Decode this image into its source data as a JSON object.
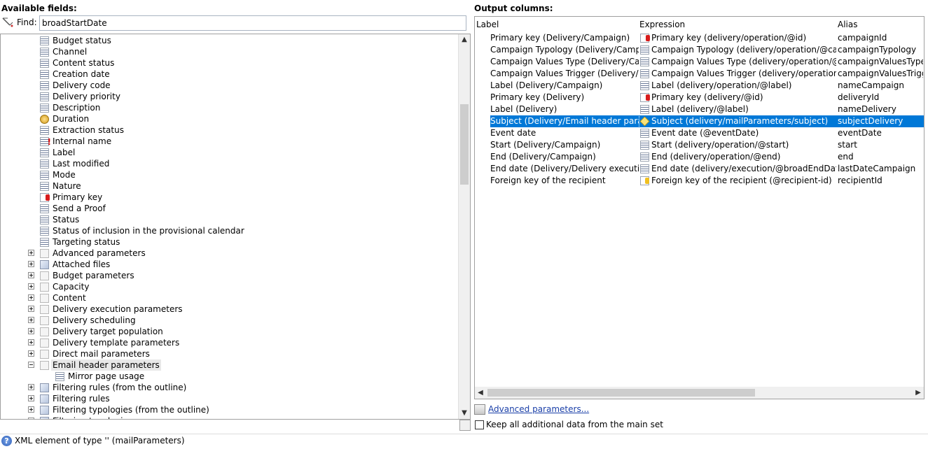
{
  "left_panel": {
    "heading": "Available fields:",
    "find_label": "Find:",
    "find_value": "broadStartDate",
    "tree_items": [
      {
        "label": "Budget status",
        "icon": "field-icon",
        "indent": 1,
        "expander": "none"
      },
      {
        "label": "Channel",
        "icon": "field-icon",
        "indent": 1,
        "expander": "none"
      },
      {
        "label": "Content status",
        "icon": "field-icon",
        "indent": 1,
        "expander": "none"
      },
      {
        "label": "Creation date",
        "icon": "field-icon",
        "indent": 1,
        "expander": "none"
      },
      {
        "label": "Delivery code",
        "icon": "field-icon",
        "indent": 1,
        "expander": "none"
      },
      {
        "label": "Delivery priority",
        "icon": "field-icon",
        "indent": 1,
        "expander": "none"
      },
      {
        "label": "Description",
        "icon": "field-icon",
        "indent": 1,
        "expander": "none"
      },
      {
        "label": "Duration",
        "icon": "duration-icon",
        "indent": 1,
        "expander": "none"
      },
      {
        "label": "Extraction status",
        "icon": "field-icon",
        "indent": 1,
        "expander": "none"
      },
      {
        "label": "Internal name",
        "icon": "mandatory-field-icon",
        "indent": 1,
        "expander": "none"
      },
      {
        "label": "Label",
        "icon": "field-icon",
        "indent": 1,
        "expander": "none"
      },
      {
        "label": "Last modified",
        "icon": "field-icon",
        "indent": 1,
        "expander": "none"
      },
      {
        "label": "Mode",
        "icon": "field-icon",
        "indent": 1,
        "expander": "none"
      },
      {
        "label": "Nature",
        "icon": "field-icon",
        "indent": 1,
        "expander": "none"
      },
      {
        "label": "Primary key",
        "icon": "primary-key-icon",
        "indent": 1,
        "expander": "none"
      },
      {
        "label": "Send a Proof",
        "icon": "field-icon",
        "indent": 1,
        "expander": "none"
      },
      {
        "label": "Status",
        "icon": "field-icon",
        "indent": 1,
        "expander": "none"
      },
      {
        "label": "Status of inclusion in the provisional calendar",
        "icon": "field-icon",
        "indent": 1,
        "expander": "none"
      },
      {
        "label": "Targeting status",
        "icon": "field-icon",
        "indent": 1,
        "expander": "none"
      },
      {
        "label": "Advanced parameters",
        "icon": "folder-icon",
        "indent": 1,
        "expander": "plus"
      },
      {
        "label": "Attached files",
        "icon": "link-icon",
        "indent": 1,
        "expander": "plus"
      },
      {
        "label": "Budget parameters",
        "icon": "folder-icon",
        "indent": 1,
        "expander": "plus"
      },
      {
        "label": "Capacity",
        "icon": "folder-icon",
        "indent": 1,
        "expander": "plus"
      },
      {
        "label": "Content",
        "icon": "folder-icon",
        "indent": 1,
        "expander": "plus"
      },
      {
        "label": "Delivery execution parameters",
        "icon": "folder-icon",
        "indent": 1,
        "expander": "plus"
      },
      {
        "label": "Delivery scheduling",
        "icon": "folder-icon",
        "indent": 1,
        "expander": "plus"
      },
      {
        "label": "Delivery target population",
        "icon": "folder-icon",
        "indent": 1,
        "expander": "plus"
      },
      {
        "label": "Delivery template parameters",
        "icon": "folder-icon",
        "indent": 1,
        "expander": "plus"
      },
      {
        "label": "Direct mail parameters",
        "icon": "folder-icon",
        "indent": 1,
        "expander": "plus"
      },
      {
        "label": "Email header parameters",
        "icon": "folder-icon",
        "indent": 1,
        "expander": "minus",
        "selected": true
      },
      {
        "label": "Mirror page usage",
        "icon": "field-icon",
        "indent": 2,
        "expander": "none"
      },
      {
        "label": "Filtering rules (from the outline)",
        "icon": "link-icon",
        "indent": 1,
        "expander": "plus"
      },
      {
        "label": "Filtering rules",
        "icon": "link-icon",
        "indent": 1,
        "expander": "plus"
      },
      {
        "label": "Filtering typologies (from the outline)",
        "icon": "link-icon",
        "indent": 1,
        "expander": "plus"
      },
      {
        "label": "Filtering typologies",
        "icon": "link-icon",
        "indent": 1,
        "expander": "plus"
      }
    ]
  },
  "right_panel": {
    "heading": "Output columns:",
    "columns": {
      "label": "Label",
      "expression": "Expression",
      "alias": "Alias"
    },
    "rows": [
      {
        "label": "Primary key (Delivery/Campaign)",
        "icon": "primary-key-icon",
        "expression": "Primary key (delivery/operation/@id)",
        "alias": "campaignId"
      },
      {
        "label": "Campaign Typology (Delivery/Campaig...",
        "icon": "field-icon",
        "expression": "Campaign Typology (delivery/operation/@campa",
        "alias": "campaignTypology"
      },
      {
        "label": "Campaign Values Type (Delivery/Cam...",
        "icon": "field-icon",
        "expression": "Campaign Values Type (delivery/operation/@c...",
        "alias": "campaignValuesType"
      },
      {
        "label": "Campaign Values Trigger (Delivery/Ca...",
        "icon": "field-icon",
        "expression": "Campaign Values Trigger (delivery/operation/@...",
        "alias": "campaignValuesTrigger"
      },
      {
        "label": "Label (Delivery/Campaign)",
        "icon": "field-icon",
        "expression": "Label (delivery/operation/@label)",
        "alias": "nameCampaign"
      },
      {
        "label": "Primary key (Delivery)",
        "icon": "primary-key-icon",
        "expression": "Primary key (delivery/@id)",
        "alias": "deliveryId"
      },
      {
        "label": "Label (Delivery)",
        "icon": "field-icon",
        "expression": "Label (delivery/@label)",
        "alias": "nameDelivery"
      },
      {
        "label": "Subject (Delivery/Email header parame...",
        "icon": "xml-element-icon",
        "expression": "Subject (delivery/mailParameters/subject)",
        "alias": "subjectDelivery",
        "selected": true
      },
      {
        "label": "Event date",
        "icon": "field-icon",
        "expression": "Event date (@eventDate)",
        "alias": "eventDate"
      },
      {
        "label": "Start (Delivery/Campaign)",
        "icon": "field-icon",
        "expression": "Start (delivery/operation/@start)",
        "alias": "start"
      },
      {
        "label": "End (Delivery/Campaign)",
        "icon": "field-icon",
        "expression": "End (delivery/operation/@end)",
        "alias": "end"
      },
      {
        "label": "End date (Delivery/Delivery execution p...",
        "icon": "field-icon",
        "expression": "End date (delivery/execution/@broadEndDate)",
        "alias": "lastDateCampaign"
      },
      {
        "label": "Foreign key of the recipient",
        "icon": "foreign-key-icon",
        "expression": "Foreign key of the recipient (@recipient-id)",
        "alias": "recipientId"
      }
    ],
    "advanced_link": "Advanced parameters...",
    "keep_label": "Keep all additional data from the main set",
    "keep_checked": false
  },
  "status_bar": {
    "icon": "help-icon",
    "text": "XML element of type '' (mailParameters)"
  }
}
